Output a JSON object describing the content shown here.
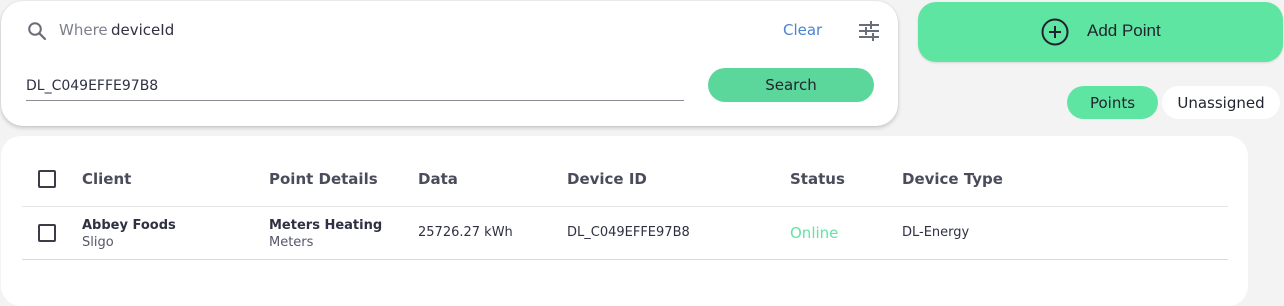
{
  "search": {
    "where_label": "Where",
    "field": "deviceId",
    "clear_label": "Clear",
    "input_value": "DL_C049EFFE97B8",
    "button_label": "Search"
  },
  "actions": {
    "add_point_label": "Add Point"
  },
  "view_toggle": {
    "points_label": "Points",
    "unassigned_label": "Unassigned",
    "active": "Points"
  },
  "table": {
    "headers": {
      "client": "Client",
      "point_details": "Point Details",
      "data": "Data",
      "device_id": "Device ID",
      "status": "Status",
      "device_type": "Device Type"
    },
    "rows": [
      {
        "client": "Abbey Foods",
        "location": "Sligo",
        "point_name": "Meters Heating",
        "point_group": "Meters",
        "data": "25726.27 kWh",
        "device_id": "DL_C049EFFE97B8",
        "status": "Online",
        "device_type": "DL-Energy"
      }
    ]
  },
  "colors": {
    "accent_green": "#5ee5a1",
    "link_blue": "#4b82d3",
    "status_online": "#5ee5a1"
  },
  "icons": [
    "search-icon",
    "filter-icon",
    "add-circle-icon"
  ]
}
